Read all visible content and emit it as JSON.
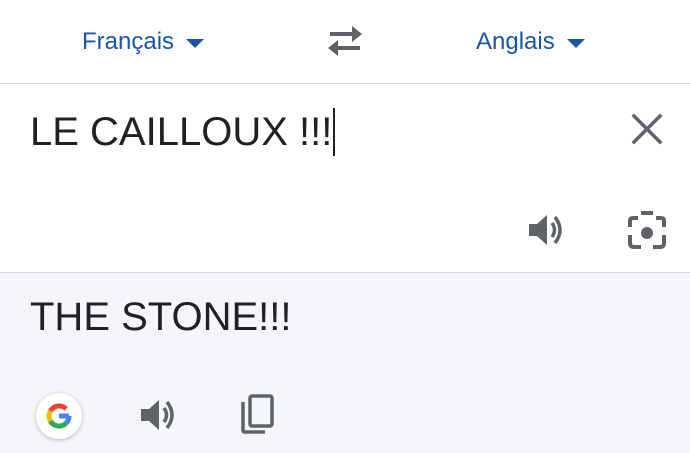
{
  "lang_bar": {
    "source_lang": "Français",
    "target_lang": "Anglais",
    "swap_icon": "swap-arrows-icon"
  },
  "input": {
    "text": "LE CAILLOUX !!!",
    "clear_icon": "close-icon",
    "speaker_icon": "speaker-icon",
    "camera_icon": "camera-icon"
  },
  "output": {
    "text": "THE STONE!!!",
    "logo_icon": "google-logo-icon",
    "speaker_icon": "speaker-icon",
    "copy_icon": "copy-icon"
  },
  "colors": {
    "accent": "#1a56a8",
    "icon": "#5f6368",
    "output_bg": "#f5f6f9",
    "divider": "#dadce0"
  }
}
